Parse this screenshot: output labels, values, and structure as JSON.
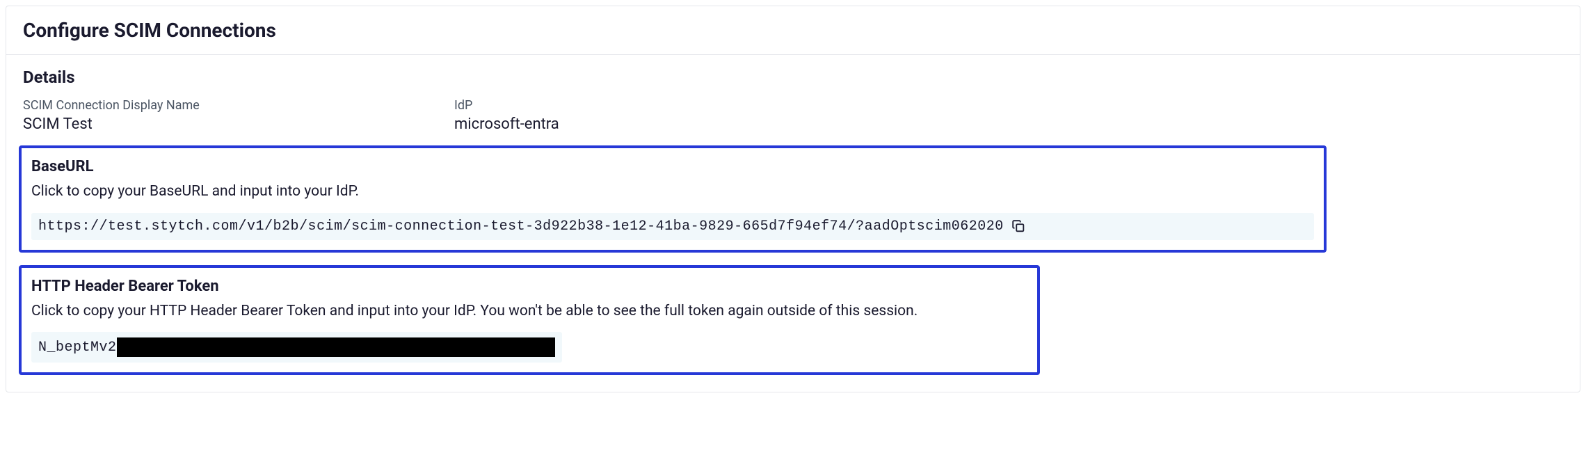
{
  "header": {
    "title": "Configure SCIM Connections"
  },
  "details": {
    "section_title": "Details",
    "display_name_label": "SCIM Connection Display Name",
    "display_name_value": "SCIM Test",
    "idp_label": "IdP",
    "idp_value": "microsoft-entra"
  },
  "baseurl": {
    "title": "BaseURL",
    "description": "Click to copy your BaseURL and input into your IdP.",
    "value": "https://test.stytch.com/v1/b2b/scim/scim-connection-test-3d922b38-1e12-41ba-9829-665d7f94ef74/?aadOptscim062020"
  },
  "token": {
    "title": "HTTP Header Bearer Token",
    "description": "Click to copy your HTTP Header Bearer Token and input into your IdP. You won't be able to see the full token again outside of this session.",
    "visible_prefix": "N_beptMv2"
  }
}
